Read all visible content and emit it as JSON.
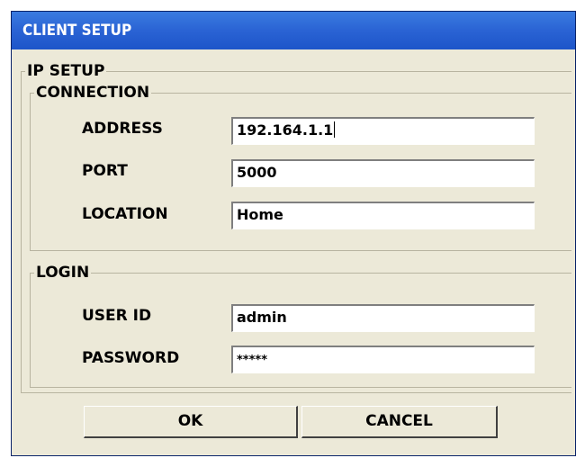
{
  "window": {
    "title": "CLIENT SETUP"
  },
  "ip_setup": {
    "legend": "IP SETUP",
    "connection": {
      "legend": "CONNECTION",
      "address": {
        "label": "ADDRESS",
        "value": "192.164.1.1"
      },
      "port": {
        "label": "PORT",
        "value": "5000"
      },
      "location": {
        "label": "LOCATION",
        "value": "Home"
      }
    },
    "login": {
      "legend": "LOGIN",
      "user_id": {
        "label": "USER ID",
        "value": "admin"
      },
      "password": {
        "label": "PASSWORD",
        "value": "*****"
      }
    }
  },
  "buttons": {
    "ok": "OK",
    "cancel": "CANCEL"
  },
  "colors": {
    "titlebar": "#2a63d4",
    "dialog_bg": "#ece9d8",
    "title_text": "#ffffff"
  }
}
